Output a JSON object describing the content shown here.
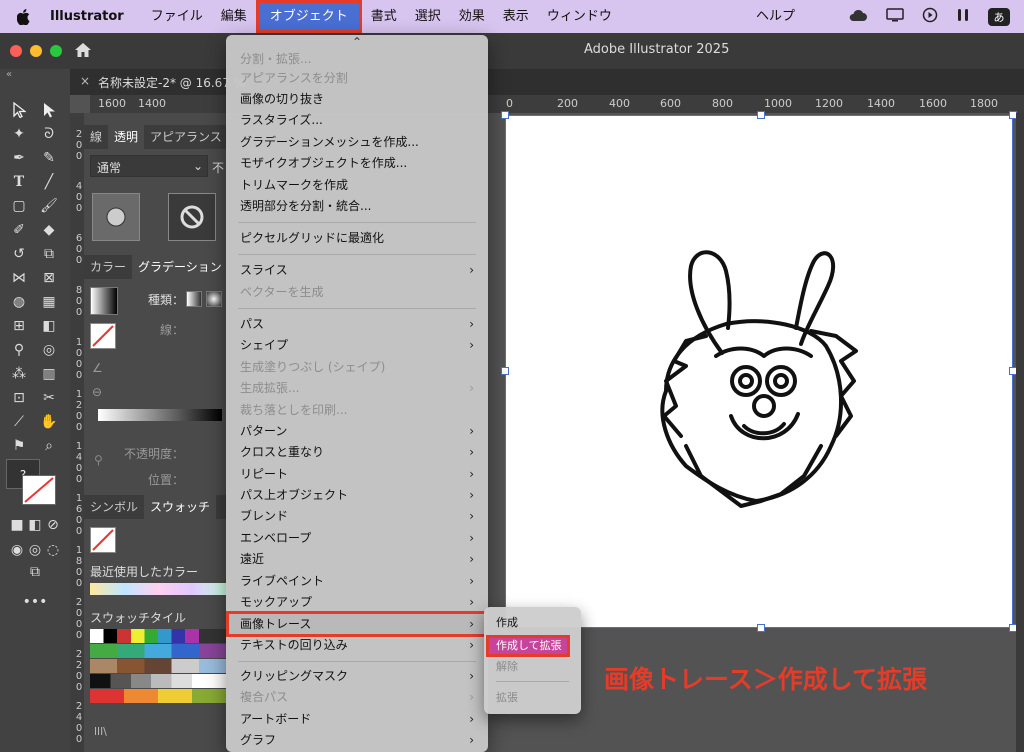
{
  "menubar": {
    "app_name": "Illustrator",
    "items": [
      {
        "label": "ファイル"
      },
      {
        "label": "編集"
      },
      {
        "label": "オブジェクト",
        "active": true
      },
      {
        "label": "書式"
      },
      {
        "label": "選択"
      },
      {
        "label": "効果"
      },
      {
        "label": "表示"
      },
      {
        "label": "ウィンドウ"
      }
    ],
    "help": "ヘルプ",
    "ime": "あ"
  },
  "window": {
    "title": "Adobe Illustrator 2025"
  },
  "document_tab": {
    "name": "名称未設定-2* @ 16.67 %"
  },
  "ruler": {
    "h_ticks": [
      "1600",
      "1400",
      "0",
      "200",
      "400",
      "600",
      "800",
      "1000",
      "1200",
      "1400",
      "1600",
      "1800"
    ],
    "v_ticks": [
      "200",
      "400",
      "600",
      "800",
      "1000",
      "1200",
      "1400",
      "1600",
      "1800",
      "2000",
      "2200",
      "2400"
    ]
  },
  "panels": {
    "transparency_tabs": [
      "線",
      "透明",
      "アピアランス"
    ],
    "blend_mode": "通常",
    "opacity_label_short": "不",
    "color_tabs": [
      "カラー",
      "グラデーション"
    ],
    "type_label": "種類：",
    "stroke_label": "線：",
    "opacity_label": "不透明度：",
    "position_label": "位置：",
    "swatch_tabs": [
      "シンボル",
      "スウォッチ"
    ],
    "recent_colors": "最近使用したカラー",
    "swatch_tile": "スウォッチタイル"
  },
  "object_menu": {
    "items": [
      {
        "label": "分割・拡張...",
        "disabled": true
      },
      {
        "label": "アピアランスを分割",
        "disabled": true
      },
      {
        "label": "画像の切り抜き"
      },
      {
        "label": "ラスタライズ..."
      },
      {
        "label": "グラデーションメッシュを作成..."
      },
      {
        "label": "モザイクオブジェクトを作成..."
      },
      {
        "label": "トリムマークを作成"
      },
      {
        "label": "透明部分を分割・統合..."
      },
      {
        "label": "ピクセルグリッドに最適化"
      },
      {
        "label": "スライス",
        "submenu": true
      },
      {
        "label": "ベクターを生成",
        "disabled": true
      },
      {
        "label": "パス",
        "submenu": true
      },
      {
        "label": "シェイプ",
        "submenu": true
      },
      {
        "label": "生成塗りつぶし (シェイプ)",
        "disabled": true
      },
      {
        "label": "生成拡張...",
        "disabled": true,
        "submenu": true
      },
      {
        "label": "裁ち落としを印刷...",
        "disabled": true
      },
      {
        "label": "パターン",
        "submenu": true
      },
      {
        "label": "クロスと重なり",
        "submenu": true
      },
      {
        "label": "リピート",
        "submenu": true
      },
      {
        "label": "パス上オブジェクト",
        "submenu": true
      },
      {
        "label": "ブレンド",
        "submenu": true
      },
      {
        "label": "エンベロープ",
        "submenu": true
      },
      {
        "label": "遠近",
        "submenu": true
      },
      {
        "label": "ライブペイント",
        "submenu": true
      },
      {
        "label": "モックアップ",
        "submenu": true
      },
      {
        "label": "画像トレース",
        "submenu": true,
        "highlighted": true
      },
      {
        "label": "テキストの回り込み",
        "submenu": true
      },
      {
        "label": "クリッピングマスク",
        "submenu": true
      },
      {
        "label": "複合パス",
        "disabled": true,
        "submenu": true
      },
      {
        "label": "アートボード",
        "submenu": true
      },
      {
        "label": "グラフ",
        "submenu": true
      }
    ],
    "submenu_arrow": "›",
    "scroll_up": "⌃"
  },
  "image_trace_submenu": {
    "items": [
      {
        "label": "作成"
      },
      {
        "label": "作成して拡張",
        "highlighted": true
      },
      {
        "label": "解除",
        "disabled": true
      },
      {
        "label": "拡張",
        "disabled": true
      }
    ]
  },
  "annotation": "画像トレース＞作成して拡張",
  "colors": {
    "menubar_bg": "#d7c4ef",
    "highlight_border": "#e53c2a",
    "selection_blue": "#4a6fd3",
    "submenu_highlight": "#c6449a"
  }
}
